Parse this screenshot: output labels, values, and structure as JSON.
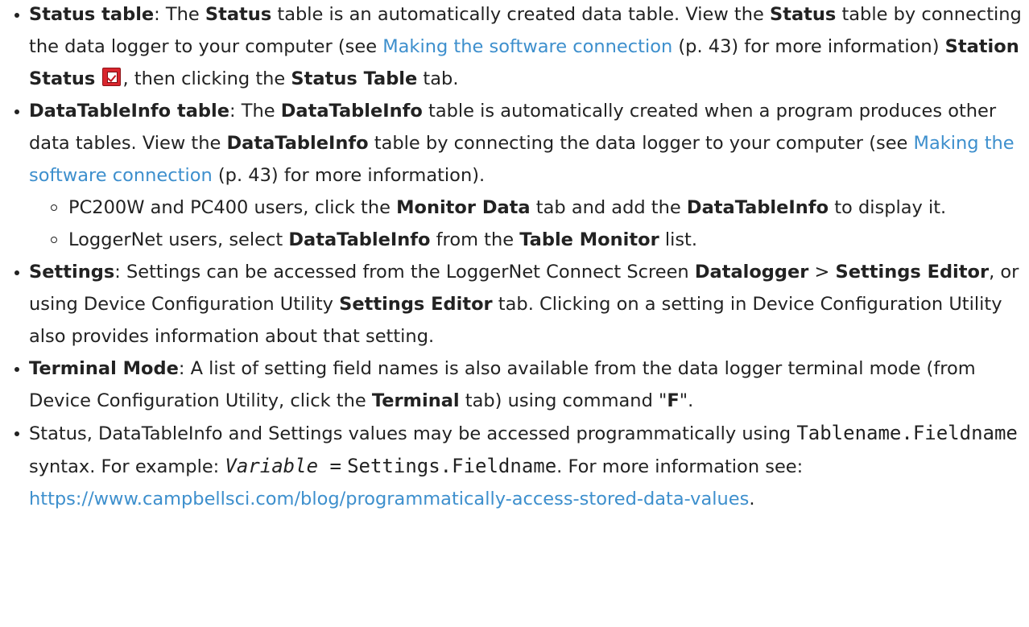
{
  "items": {
    "status": {
      "term": "Status table",
      "t1": ": The ",
      "b1": "Status",
      "t2": " table is an automatically created data table. View the ",
      "b2": "Status",
      "t3": " table by connecting the data logger to your computer (see ",
      "link": "Making the software connection",
      "t4": " (p. 43) for more information) ",
      "b3": "Station Status",
      "icon": "station-status-icon",
      "t5": ", then clicking the ",
      "b4": "Status Table",
      "t6": " tab."
    },
    "datatableinfo": {
      "term": "DataTableInfo table",
      "t1": ": The ",
      "b1": "DataTableInfo",
      "t2": " table is automatically created when a program produces other data tables. View the ",
      "b2": "DataTableInfo",
      "t3": " table by connecting the data logger to your computer (see ",
      "link": "Making the software connection",
      "t4": " (p. 43) for more information).",
      "sub": [
        {
          "t1": "PC200W and PC400 users, click the ",
          "b1": "Monitor Data",
          "t2": " tab and add the ",
          "b2": "DataTableInfo",
          "t3": " to display it."
        },
        {
          "t1": "LoggerNet users, select ",
          "b1": "DataTableInfo",
          "t2": " from the ",
          "b2": "Table Monitor",
          "t3": " list."
        }
      ]
    },
    "settings": {
      "term": "Settings",
      "t1": ": Settings can be accessed from the LoggerNet Connect Screen ",
      "b1": "Datalogger",
      "t2": " > ",
      "b2": "Settings Editor",
      "t3": ", or using Device Configuration Utility ",
      "b3": "Settings Editor",
      "t4": " tab. Clicking on a setting in Device Configuration Utility also provides information about that setting."
    },
    "terminal": {
      "term": "Terminal Mode",
      "t1": ": A list of setting field names is also available from the data logger terminal mode (from Device Configuration Utility, click the ",
      "b1": "Terminal",
      "t2": " tab) using command \"",
      "b2": "F",
      "t3": "\"."
    },
    "access": {
      "t1": "Status, DataTableInfo and Settings values may be accessed programmatically using ",
      "code1": "Tablename.Fieldname",
      "t2": " syntax. For example: ",
      "em1": "Variable =",
      "code2": "Settings.Fieldname",
      "t3": ". For more information see: ",
      "link": "https://www.campbellsci.com/blog/programmatically-access-stored-data-values",
      "t4": "."
    }
  }
}
